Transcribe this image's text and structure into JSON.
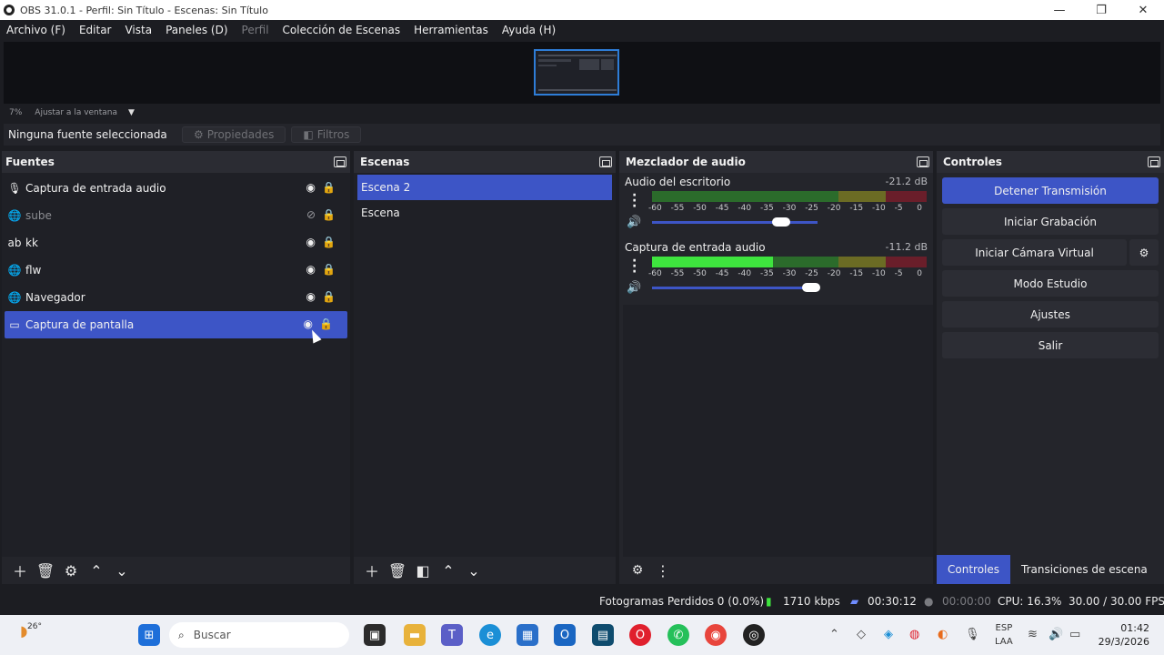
{
  "window": {
    "title": "OBS 31.0.1 - Perfil: Sin Título - Escenas: Sin Título",
    "buttons": [
      "—",
      "❐",
      "✕"
    ]
  },
  "menu": [
    {
      "label": "Archivo (F)",
      "enabled": true
    },
    {
      "label": "Editar",
      "enabled": true
    },
    {
      "label": "Vista",
      "enabled": true
    },
    {
      "label": "Paneles (D)",
      "enabled": true
    },
    {
      "label": "Perfil",
      "enabled": false
    },
    {
      "label": "Colección de Escenas",
      "enabled": true
    },
    {
      "label": "Herramientas",
      "enabled": true
    },
    {
      "label": "Ayuda (H)",
      "enabled": true
    }
  ],
  "zoom": {
    "percent": "7%",
    "mode": "Ajustar a la ventana"
  },
  "source_toolbar": {
    "no_source": "Ninguna fuente seleccionada",
    "properties": "Propiedades",
    "filters": "Filtros"
  },
  "sources": {
    "title": "Fuentes",
    "items": [
      {
        "label": "Captura de entrada audio",
        "icon": "microphone-icon",
        "glyph": "🎙",
        "visible": true,
        "selected": false
      },
      {
        "label": "sube",
        "icon": "browser-icon",
        "glyph": "🌐",
        "visible": false,
        "selected": false
      },
      {
        "label": "kk",
        "icon": "text-icon",
        "glyph": "ab",
        "visible": true,
        "selected": false
      },
      {
        "label": "flw",
        "icon": "browser-icon",
        "glyph": "🌐",
        "visible": true,
        "selected": false
      },
      {
        "label": "Navegador",
        "icon": "browser-icon",
        "glyph": "🌐",
        "visible": true,
        "selected": false
      },
      {
        "label": "Captura de pantalla",
        "icon": "monitor-icon",
        "glyph": "▭",
        "visible": true,
        "selected": true
      }
    ]
  },
  "scenes": {
    "title": "Escenas",
    "items": [
      {
        "label": "Escena 2",
        "selected": true
      },
      {
        "label": "Escena",
        "selected": false
      }
    ]
  },
  "mixer": {
    "title": "Mezclador de audio",
    "ticks": [
      "-60",
      "-55",
      "-50",
      "-45",
      "-40",
      "-35",
      "-30",
      "-25",
      "-20",
      "-15",
      "-10",
      "-5",
      "0"
    ],
    "channels": [
      {
        "name": "Audio del escritorio",
        "db": "-21.2 dB",
        "level": 0,
        "volume": 0.78
      },
      {
        "name": "Captura de entrada audio",
        "db": "-11.2 dB",
        "level": 0.44,
        "volume": 0.96
      }
    ]
  },
  "controls": {
    "title": "Controles",
    "stop_stream": "Detener Transmisión",
    "start_recording": "Iniciar Grabación",
    "start_virtual_cam": "Iniciar Cámara Virtual",
    "studio_mode": "Modo Estudio",
    "settings": "Ajustes",
    "exit": "Salir",
    "tabs": [
      "Controles",
      "Transiciones de escena"
    ]
  },
  "status": {
    "dropped_frames": "Fotogramas Perdidos 0 (0.0%)",
    "bitrate": "1710 kbps",
    "stream_time": "00:30:12",
    "record_time": "00:00:00",
    "cpu": "CPU: 16.3%",
    "fps": "30.00 / 30.00 FPS"
  },
  "taskbar": {
    "weather": "26°",
    "search_placeholder": "Buscar",
    "lang_1": "ESP",
    "lang_2": "LAA",
    "time": "01:42",
    "date": "29/3/2026"
  },
  "colors": {
    "accent": "#3d55c6",
    "panel": "#24252b",
    "background": "#1c1d22"
  }
}
